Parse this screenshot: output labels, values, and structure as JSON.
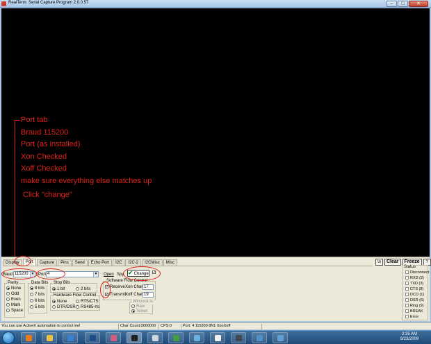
{
  "window": {
    "title": "RealTerm: Serial Capture Program 2.0.0.57",
    "controls": {
      "minimize": "–",
      "maximize": "□",
      "close": "✕"
    }
  },
  "annotation_note": {
    "lines": [
      "Port tab",
      "Braud 115200",
      "Port (as installed)",
      "Xon Checked",
      "Xoff Checked",
      "make sure everything else matches up"
    ],
    "click_line": "Click \"change\""
  },
  "tabs": [
    {
      "label": "Display",
      "active": false
    },
    {
      "label": "Port",
      "active": true
    },
    {
      "label": "Capture",
      "active": false
    },
    {
      "label": "Pins",
      "active": false
    },
    {
      "label": "Send",
      "active": false
    },
    {
      "label": "Echo Port",
      "active": false
    },
    {
      "label": "I2C",
      "active": false
    },
    {
      "label": "I2C-2",
      "active": false
    },
    {
      "label": "I2CMisc",
      "active": false
    },
    {
      "label": "Misc",
      "active": false
    }
  ],
  "toolbar": {
    "back_label": "\\n",
    "clear_label": "Clear",
    "freeze_label": "Freeze",
    "help_label": "?"
  },
  "port": {
    "baud_label": "Baud",
    "baud_value": "115200",
    "port_label": "Port",
    "port_value": "4",
    "open_label": "Open",
    "spy_label": "Spy",
    "change_label": "Change"
  },
  "parity": {
    "title": "Parity",
    "options": [
      "None",
      "Odd",
      "Even",
      "Mark",
      "Space"
    ],
    "selected": 0
  },
  "data_bits": {
    "title": "Data Bits",
    "options": [
      "8 bits",
      "7 bits",
      "6 bits",
      "5 bits"
    ],
    "selected": 0
  },
  "stop_bits": {
    "title": "Stop Bits",
    "options": [
      "1 bit",
      "2 bits"
    ],
    "selected": 0
  },
  "hw_flow": {
    "title": "Hardware Flow Control",
    "options": [
      "None",
      "RTS/CTS",
      "DTR/DSR",
      "RS485-rts"
    ],
    "selected": 0
  },
  "sw_flow": {
    "title": "Software Flow Control",
    "receive_label": "Receive",
    "transmit_label": "Transmit",
    "xon_label": "Xon Char:",
    "xon_value": "17",
    "xoff_label": "Xoff Char:",
    "xoff_value": "19"
  },
  "winsock": {
    "title": "Winsock is:",
    "options": [
      "Raw",
      "Telnet"
    ],
    "selected": 1
  },
  "status": {
    "title": "Status",
    "items": [
      "Disconnect",
      "RXD (2)",
      "TXD (3)",
      "CTS (8)",
      "DCD (1)",
      "DSR (6)",
      "Ring (9)",
      "BREAK",
      "Error"
    ]
  },
  "statusbar": {
    "hint": "You can use ActiveX automation to control me!",
    "char_count": "Char Count:0000000",
    "cps": "CPS:0",
    "port_info": "Port: 4 115200 8N1 XonXoff"
  },
  "taskbar": {
    "time": "2:35 AM",
    "date": "9/23/2009",
    "icons": [
      "firefox-icon",
      "folder-icon",
      "media-player-icon",
      "photoshop-icon",
      "paint-icon",
      "realterm-icon",
      "notepad-icon",
      "tool-icon",
      "chart-icon",
      "rockstar-icon",
      "terminal-icon",
      "explorer-icon",
      "network-icon"
    ]
  }
}
